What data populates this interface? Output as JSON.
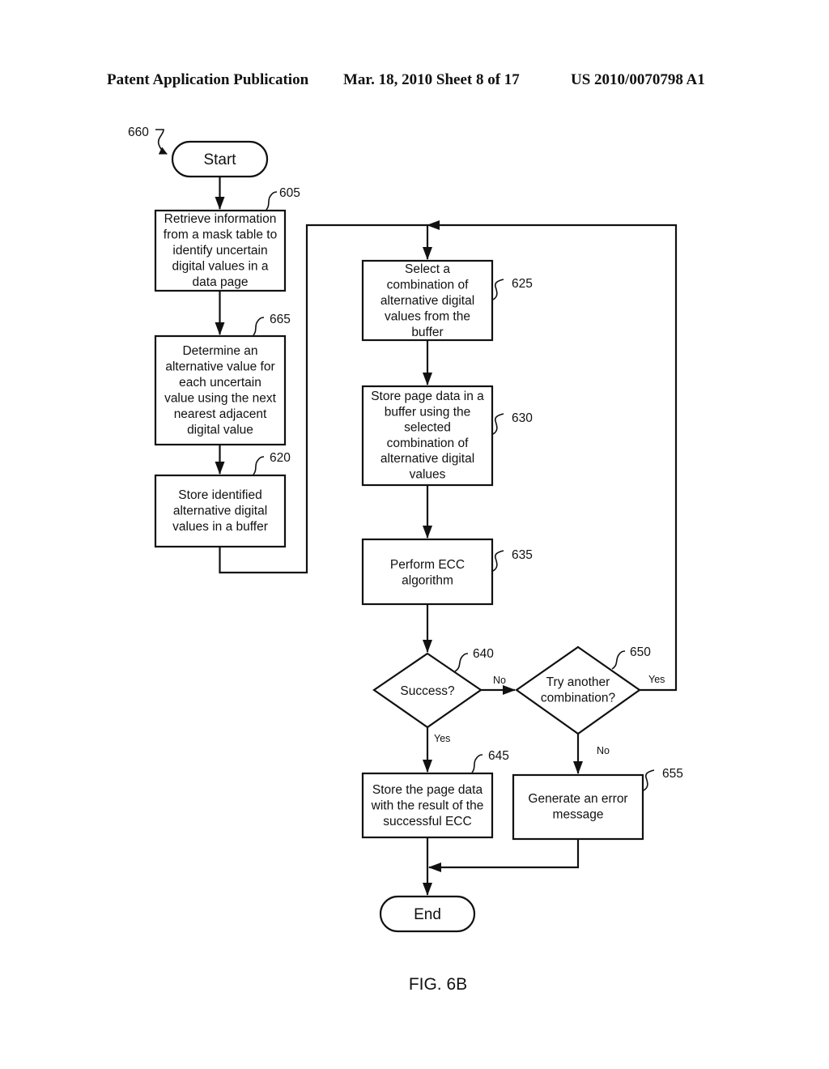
{
  "header": {
    "publication": "Patent Application Publication",
    "date_sheet": "Mar. 18, 2010  Sheet 8 of 17",
    "number": "US 2010/0070798 A1"
  },
  "figure": {
    "label": "FIG. 6B",
    "ref": "660"
  },
  "nodes": {
    "start": {
      "text": "Start"
    },
    "n605": {
      "ref": "605",
      "lines": [
        "Retrieve information",
        "from a mask table to",
        "identify uncertain",
        "digital values in a",
        "data page"
      ]
    },
    "n665": {
      "ref": "665",
      "lines": [
        "Determine an",
        "alternative value for",
        "each uncertain",
        "value using the next",
        "nearest adjacent",
        "digital value"
      ]
    },
    "n620": {
      "ref": "620",
      "lines": [
        "Store identified",
        "alternative digital",
        "values in a buffer"
      ]
    },
    "n625": {
      "ref": "625",
      "lines": [
        "Select a",
        "combination of",
        "alternative digital",
        "values from the",
        "buffer"
      ]
    },
    "n630": {
      "ref": "630",
      "lines": [
        "Store page data in a",
        "buffer using the",
        "selected",
        "combination of",
        "alternative digital",
        "values"
      ]
    },
    "n635": {
      "ref": "635",
      "lines": [
        "Perform ECC",
        "algorithm"
      ]
    },
    "n640": {
      "ref": "640",
      "lines": [
        "Success?"
      ]
    },
    "n650": {
      "ref": "650",
      "lines": [
        "Try another",
        "combination?"
      ]
    },
    "n645": {
      "ref": "645",
      "lines": [
        "Store the page data",
        "with the result of the",
        "successful ECC"
      ]
    },
    "n655": {
      "ref": "655",
      "lines": [
        "Generate an error",
        "message"
      ]
    },
    "end": {
      "text": "End"
    }
  },
  "edges": {
    "e640_no": "No",
    "e640_yes": "Yes",
    "e650_yes": "Yes",
    "e650_no": "No"
  }
}
